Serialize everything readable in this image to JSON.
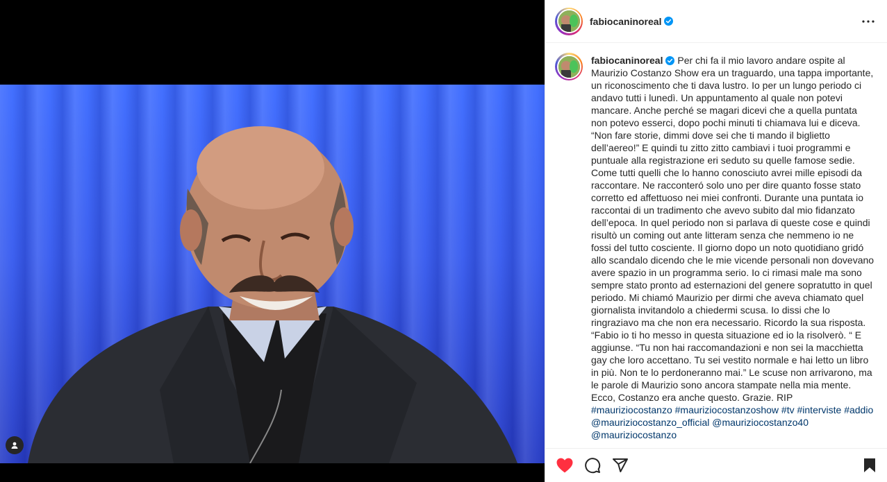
{
  "post": {
    "username": "fabiocaninoreal",
    "verified": true,
    "icons": {
      "more": "more-options-icon",
      "like": "heart-filled-icon",
      "comment": "comment-icon",
      "share": "share-icon",
      "save": "bookmark-icon",
      "tags": "user-tag-icon",
      "verified": "verified-badge-icon"
    },
    "colors": {
      "like": "#ff3040",
      "verified": "#0095f6",
      "link": "#00376b"
    }
  },
  "caption": {
    "username": "fabiocaninoreal",
    "body": "Per chi fa il mio lavoro andare ospite al Maurizio Costanzo Show era un traguardo, una tappa importante, un riconoscimento che ti dava lustro. Io per un lungo periodo ci andavo tutti i lunedì. Un appuntamento al quale non potevi mancare. Anche perché se magari dicevi che a quella puntata non potevo esserci, dopo pochi minuti ti chiamava lui e diceva. “Non fare storie, dimmi dove sei che ti mando il biglietto dell’aereo!” E quindi tu zitto zitto cambiavi i tuoi programmi e puntuale alla registrazione eri seduto su quelle famose sedie. Come tutti quelli che lo hanno conosciuto avrei mille episodi da raccontare. Ne racconteró solo uno per dire quanto fosse stato corretto ed affettuoso nei miei confronti. Durante una puntata io raccontai di un tradimento che avevo subito dal mio fidanzato dell’epoca. In quel periodo non si parlava di queste cose e quindi risultò un coming out ante litteram senza che nemmeno io ne fossi del tutto cosciente. Il giorno dopo un noto quotidiano gridó allo scandalo dicendo che le mie vicende personali non dovevano avere spazio in un programma serio. Io ci rimasi male ma sono sempre stato pronto ad esternazioni del genere sopratutto in quel periodo. Mi chiamó Maurizio per dirmi che aveva chiamato quel giornalista invitandolo a chiedermi scusa. Io dissi che lo ringraziavo ma che non era necessario. Ricordo la sua risposta. “Fabio io ti ho messo in questa situazione ed io la risolverò. “ E aggiunse. “Tu non hai raccomandazioni e non sei la macchietta gay che loro accettano. Tu sei vestito normale e hai letto un libro in più. Non te lo perdoneranno mai.” Le scuse non arrivarono, ma le parole di Maurizio sono ancora stampate nella mia mente. Ecco, Costanzo era anche questo. Grazie.",
    "rip": "RIP",
    "tags": [
      "#mauriziocostanzo",
      "#mauriziocostanzoshow",
      "#tv",
      "#interviste",
      "#addio",
      "@mauriziocostanzo_official"
    ],
    "cut_line": "@mauriziocostanzo40 @mauriziocostanzo"
  }
}
